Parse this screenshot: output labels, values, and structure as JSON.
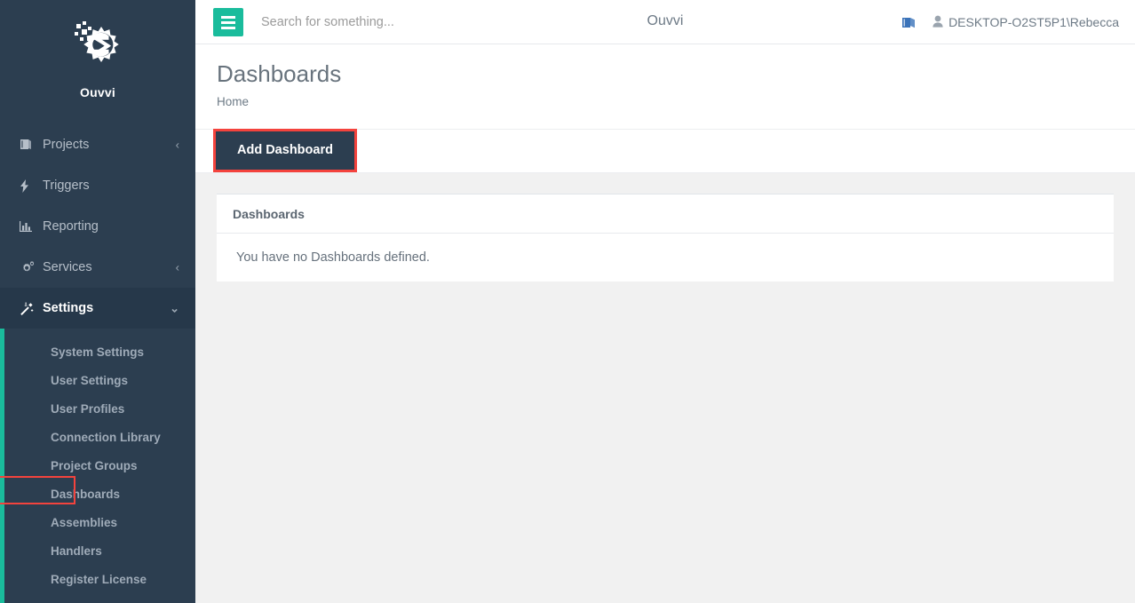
{
  "brand": {
    "name": "Ouvvi",
    "logo_icon": "gear-s-logo-icon"
  },
  "sidebar": {
    "items": [
      {
        "label": "Projects",
        "icon": "book-icon",
        "caret": "‹",
        "active": false
      },
      {
        "label": "Triggers",
        "icon": "bolt-icon",
        "caret": "",
        "active": false
      },
      {
        "label": "Reporting",
        "icon": "bar-chart-icon",
        "caret": "",
        "active": false
      },
      {
        "label": "Services",
        "icon": "gears-icon",
        "caret": "‹",
        "active": false
      },
      {
        "label": "Settings",
        "icon": "magic-wand-icon",
        "caret": "⌄",
        "active": true
      }
    ],
    "subitems": [
      {
        "label": "System Settings",
        "highlighted": false
      },
      {
        "label": "User Settings",
        "highlighted": false
      },
      {
        "label": "User Profiles",
        "highlighted": false
      },
      {
        "label": "Connection Library",
        "highlighted": false
      },
      {
        "label": "Project Groups",
        "highlighted": false
      },
      {
        "label": "Dashboards",
        "highlighted": true
      },
      {
        "label": "Assemblies",
        "highlighted": false
      },
      {
        "label": "Handlers",
        "highlighted": false
      },
      {
        "label": "Register License",
        "highlighted": false
      }
    ],
    "accent_color": "#1abc9c",
    "background_color": "#2c3e50"
  },
  "header": {
    "menu_icon": "hamburger-icon",
    "search_placeholder": "Search for something...",
    "search_value": "",
    "title": "Ouvvi",
    "help_icon": "book-icon",
    "user_icon": "user-icon",
    "username": "DESKTOP-O2ST5P1\\Rebecca"
  },
  "page": {
    "title": "Dashboards",
    "breadcrumb": "Home"
  },
  "toolbar": {
    "add_dashboard_label": "Add Dashboard",
    "highlight_color": "#f4433d"
  },
  "panel": {
    "header": "Dashboards",
    "empty_message": "You have no Dashboards defined."
  }
}
